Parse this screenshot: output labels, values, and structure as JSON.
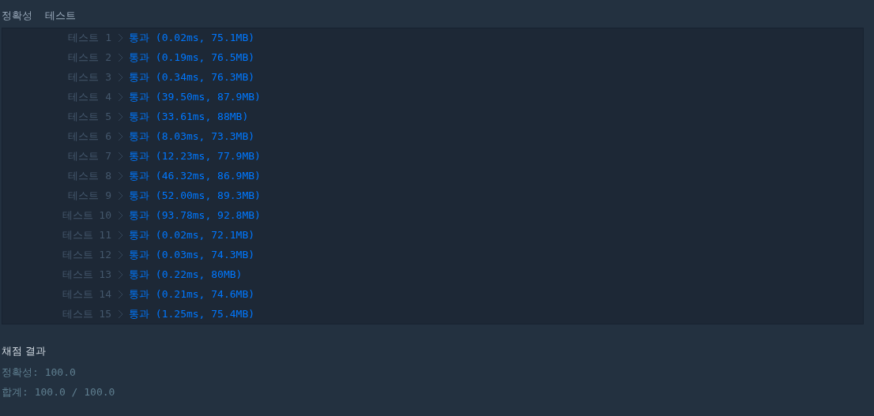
{
  "header": {
    "tab_1": "정확성",
    "tab_2": "테스트"
  },
  "tests": [
    {
      "label": "테스트 1",
      "result": "통과 (0.02ms, 75.1MB)",
      "passed": true
    },
    {
      "label": "테스트 2",
      "result": "통과 (0.19ms, 76.5MB)",
      "passed": true
    },
    {
      "label": "테스트 3",
      "result": "통과 (0.34ms, 76.3MB)",
      "passed": true
    },
    {
      "label": "테스트 4",
      "result": "통과 (39.50ms, 87.9MB)",
      "passed": true
    },
    {
      "label": "테스트 5",
      "result": "통과 (33.61ms, 88MB)",
      "passed": true
    },
    {
      "label": "테스트 6",
      "result": "통과 (8.03ms, 73.3MB)",
      "passed": true
    },
    {
      "label": "테스트 7",
      "result": "통과 (12.23ms, 77.9MB)",
      "passed": true
    },
    {
      "label": "테스트 8",
      "result": "통과 (46.32ms, 86.9MB)",
      "passed": true
    },
    {
      "label": "테스트 9",
      "result": "통과 (52.00ms, 89.3MB)",
      "passed": true
    },
    {
      "label": "테스트 10",
      "result": "통과 (93.78ms, 92.8MB)",
      "passed": true
    },
    {
      "label": "테스트 11",
      "result": "통과 (0.02ms, 72.1MB)",
      "passed": true
    },
    {
      "label": "테스트 12",
      "result": "통과 (0.03ms, 74.3MB)",
      "passed": true
    },
    {
      "label": "테스트 13",
      "result": "통과 (0.22ms, 80MB)",
      "passed": true
    },
    {
      "label": "테스트 14",
      "result": "통과 (0.21ms, 74.6MB)",
      "passed": true
    },
    {
      "label": "테스트 15",
      "result": "통과 (1.25ms, 75.4MB)",
      "passed": true
    }
  ],
  "summary": {
    "title": "채점 결과",
    "accuracy": "정확성: 100.0",
    "total": "합계: 100.0 / 100.0"
  }
}
